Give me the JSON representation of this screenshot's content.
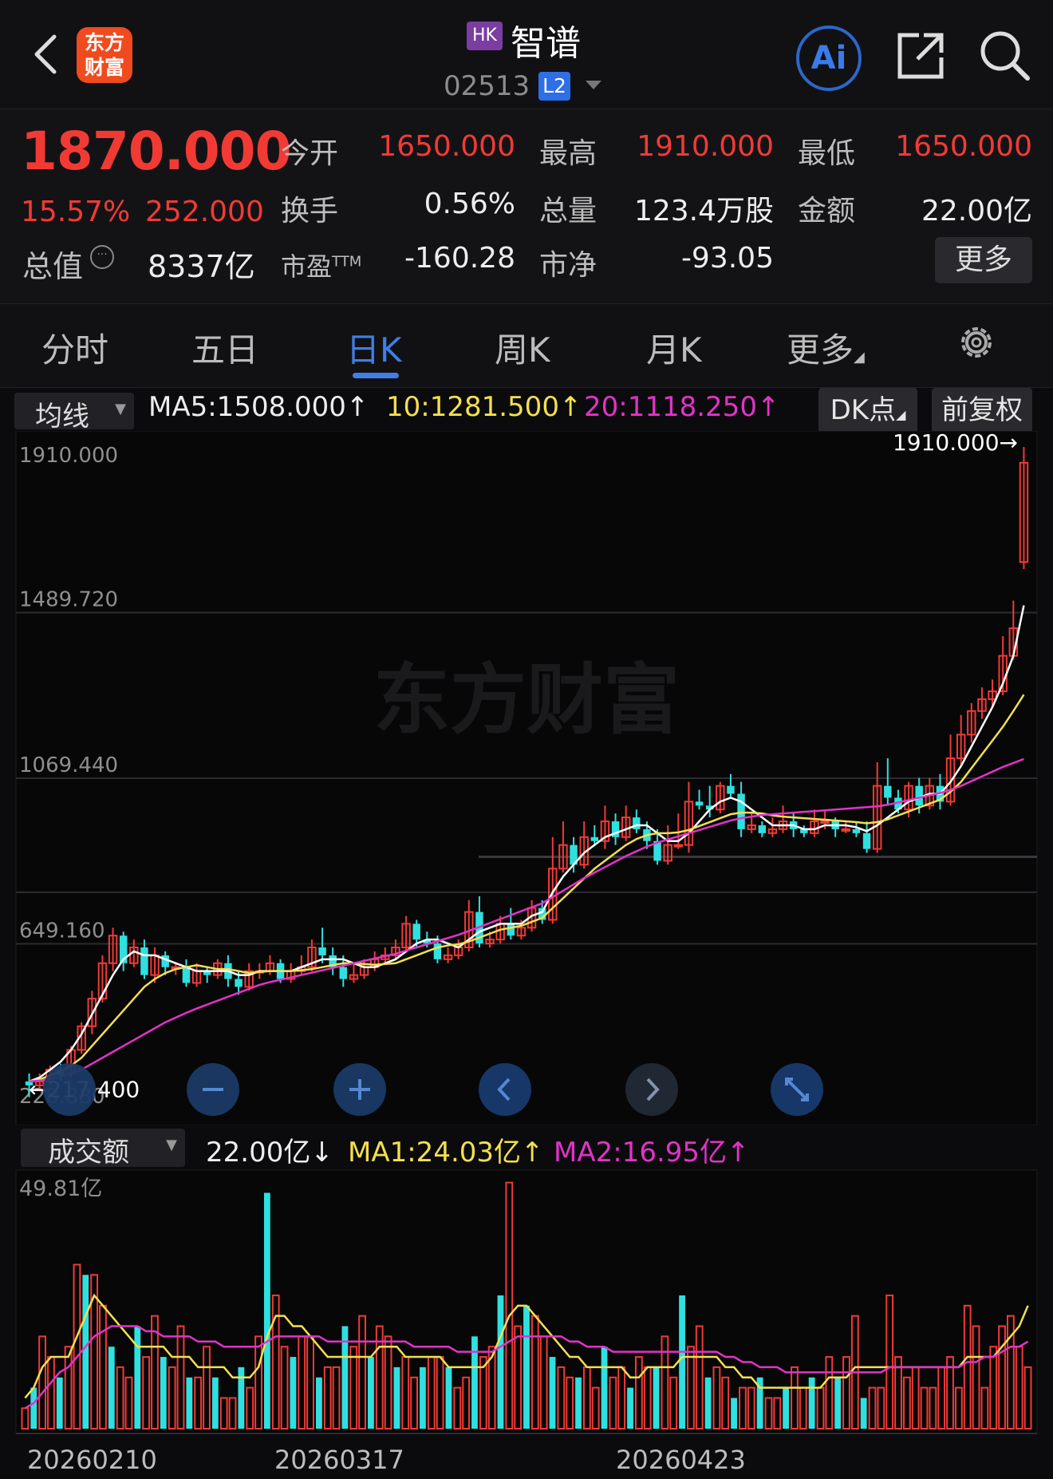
{
  "header": {
    "logo_text_1": "东方",
    "logo_text_2": "财富",
    "market_badge": "HK",
    "stock_name": "智谱",
    "stock_code": "02513",
    "level_badge": "L2",
    "ai_label": "Ai"
  },
  "quote": {
    "price": "1870.000",
    "change_pct": "15.57%",
    "change_amt": "252.000",
    "market_cap_label": "总值",
    "market_cap_value": "8337亿",
    "fields": [
      {
        "label": "今开",
        "value": "1650.000",
        "color": "red"
      },
      {
        "label": "最高",
        "value": "1910.000",
        "color": "red"
      },
      {
        "label": "最低",
        "value": "1650.000",
        "color": "red"
      },
      {
        "label": "换手",
        "value": "0.56%",
        "color": "white"
      },
      {
        "label": "总量",
        "value": "123.4万股",
        "color": "white"
      },
      {
        "label": "金额",
        "value": "22.00亿",
        "color": "white"
      },
      {
        "label": "市盈",
        "label_sup": "TTM",
        "value": "-160.28",
        "color": "white"
      },
      {
        "label": "市净",
        "value": "-93.05",
        "color": "white"
      }
    ],
    "more_label": "更多"
  },
  "tabs": [
    "分时",
    "五日",
    "日K",
    "周K",
    "月K",
    "更多"
  ],
  "active_tab": "日K",
  "ma_row": {
    "selector": "均线",
    "ma5": "MA5:1508.000↑",
    "ma10": "10:1281.500↑",
    "ma20": "20:1118.250↑",
    "dk_label": "DK点",
    "adjust_label": "前复权"
  },
  "volume_row": {
    "selector": "成交额",
    "current": "22.00亿↓",
    "ma1": "MA1:24.03亿↑",
    "ma2": "MA2:16.95亿↑"
  },
  "colors": {
    "up": "#f23a35",
    "down": "#2fe0e0",
    "ma5": "#ffffff",
    "ma10": "#f3e04f",
    "ma20": "#e233c8",
    "accent": "#3f7ee8"
  },
  "chart_data": [
    {
      "type": "candlestick",
      "title": "",
      "y_ticks": [
        "1910.000",
        "1489.720",
        "1069.440",
        "649.160",
        "228.880"
      ],
      "ylim": [
        228.88,
        1910.0
      ],
      "high_annotation": "1910.000→",
      "low_annotation": "←217.400",
      "watermark": "东方财富",
      "reference_line": 870,
      "candles": [
        [
          300,
          290,
          320,
          260
        ],
        [
          290,
          300,
          320,
          280
        ],
        [
          300,
          330,
          340,
          295
        ],
        [
          330,
          315,
          345,
          300
        ],
        [
          320,
          380,
          390,
          310
        ],
        [
          380,
          440,
          450,
          370
        ],
        [
          440,
          510,
          530,
          420
        ],
        [
          510,
          600,
          620,
          500
        ],
        [
          600,
          670,
          690,
          580
        ],
        [
          670,
          600,
          680,
          580
        ],
        [
          600,
          640,
          660,
          590
        ],
        [
          640,
          570,
          660,
          560
        ],
        [
          570,
          620,
          640,
          550
        ],
        [
          620,
          590,
          630,
          570
        ],
        [
          590,
          590,
          600,
          570
        ],
        [
          590,
          550,
          610,
          540
        ],
        [
          550,
          580,
          600,
          540
        ],
        [
          580,
          570,
          590,
          550
        ],
        [
          570,
          600,
          610,
          560
        ],
        [
          600,
          560,
          620,
          540
        ],
        [
          560,
          540,
          580,
          520
        ],
        [
          540,
          580,
          600,
          530
        ],
        [
          580,
          580,
          600,
          560
        ],
        [
          580,
          600,
          620,
          570
        ],
        [
          600,
          560,
          610,
          550
        ],
        [
          560,
          580,
          600,
          550
        ],
        [
          580,
          590,
          620,
          570
        ],
        [
          590,
          640,
          660,
          580
        ],
        [
          640,
          620,
          690,
          600
        ],
        [
          620,
          590,
          640,
          570
        ],
        [
          590,
          560,
          620,
          540
        ],
        [
          560,
          570,
          600,
          550
        ],
        [
          570,
          590,
          610,
          560
        ],
        [
          590,
          610,
          630,
          580
        ],
        [
          610,
          620,
          640,
          600
        ],
        [
          620,
          640,
          660,
          610
        ],
        [
          640,
          700,
          720,
          630
        ],
        [
          700,
          660,
          710,
          640
        ],
        [
          660,
          650,
          680,
          640
        ],
        [
          650,
          610,
          670,
          600
        ],
        [
          610,
          620,
          640,
          600
        ],
        [
          620,
          640,
          660,
          610
        ],
        [
          640,
          730,
          760,
          630
        ],
        [
          730,
          650,
          770,
          640
        ],
        [
          650,
          660,
          680,
          640
        ],
        [
          660,
          700,
          720,
          650
        ],
        [
          700,
          670,
          740,
          660
        ],
        [
          670,
          690,
          710,
          660
        ],
        [
          690,
          740,
          760,
          680
        ],
        [
          740,
          710,
          760,
          700
        ],
        [
          710,
          840,
          920,
          700
        ],
        [
          840,
          900,
          960,
          830
        ],
        [
          900,
          850,
          920,
          830
        ],
        [
          850,
          920,
          960,
          840
        ],
        [
          920,
          910,
          950,
          900
        ],
        [
          910,
          960,
          1000,
          890
        ],
        [
          960,
          920,
          980,
          900
        ],
        [
          920,
          970,
          1000,
          910
        ],
        [
          970,
          940,
          990,
          930
        ],
        [
          940,
          910,
          960,
          890
        ],
        [
          910,
          860,
          940,
          850
        ],
        [
          860,
          900,
          950,
          850
        ],
        [
          900,
          900,
          980,
          890
        ],
        [
          900,
          1010,
          1060,
          880
        ],
        [
          1010,
          1000,
          1040,
          990
        ],
        [
          1000,
          990,
          1050,
          970
        ],
        [
          990,
          1050,
          1060,
          980
        ],
        [
          1050,
          1030,
          1080,
          1020
        ],
        [
          1030,
          940,
          1060,
          920
        ],
        [
          940,
          950,
          980,
          930
        ],
        [
          950,
          930,
          960,
          920
        ],
        [
          930,
          940,
          970,
          920
        ],
        [
          940,
          960,
          1000,
          930
        ],
        [
          960,
          940,
          980,
          920
        ],
        [
          940,
          930,
          950,
          920
        ],
        [
          930,
          960,
          990,
          920
        ],
        [
          960,
          960,
          990,
          940
        ],
        [
          960,
          940,
          970,
          920
        ],
        [
          940,
          940,
          960,
          930
        ],
        [
          940,
          930,
          960,
          920
        ],
        [
          930,
          890,
          960,
          880
        ],
        [
          890,
          1050,
          1110,
          880
        ],
        [
          1050,
          1020,
          1120,
          1000
        ],
        [
          1020,
          990,
          1040,
          980
        ],
        [
          990,
          1050,
          1060,
          970
        ],
        [
          1050,
          1000,
          1070,
          980
        ],
        [
          1000,
          1050,
          1070,
          990
        ],
        [
          1050,
          1010,
          1080,
          990
        ],
        [
          1010,
          1120,
          1180,
          1000
        ],
        [
          1120,
          1180,
          1230,
          1100
        ],
        [
          1180,
          1240,
          1260,
          1160
        ],
        [
          1240,
          1270,
          1300,
          1220
        ],
        [
          1270,
          1290,
          1320,
          1250
        ],
        [
          1290,
          1380,
          1430,
          1280
        ],
        [
          1380,
          1450,
          1520,
          1370
        ],
        [
          1618,
          1870,
          1910,
          1600
        ]
      ],
      "ma5": [
        300,
        310,
        330,
        350,
        380,
        420,
        470,
        520,
        570,
        610,
        630,
        620,
        620,
        610,
        600,
        590,
        580,
        580,
        580,
        580,
        570,
        570,
        580,
        580,
        580,
        580,
        590,
        600,
        610,
        610,
        610,
        600,
        590,
        590,
        600,
        610,
        630,
        650,
        660,
        660,
        650,
        640,
        660,
        680,
        690,
        700,
        700,
        700,
        720,
        730,
        780,
        820,
        850,
        880,
        900,
        920,
        930,
        940,
        950,
        950,
        930,
        910,
        910,
        930,
        960,
        990,
        1010,
        1020,
        1010,
        990,
        970,
        950,
        950,
        950,
        940,
        940,
        950,
        950,
        950,
        945,
        935,
        950,
        970,
        990,
        1010,
        1020,
        1030,
        1030,
        1060,
        1100,
        1150,
        1200,
        1250,
        1310,
        1380,
        1508
      ],
      "ma10": [
        300,
        305,
        315,
        325,
        340,
        360,
        390,
        420,
        450,
        480,
        510,
        540,
        560,
        575,
        585,
        590,
        595,
        590,
        585,
        585,
        580,
        575,
        578,
        580,
        580,
        580,
        582,
        585,
        590,
        595,
        600,
        600,
        598,
        596,
        598,
        600,
        610,
        620,
        630,
        640,
        645,
        648,
        655,
        665,
        675,
        685,
        690,
        695,
        705,
        715,
        740,
        765,
        790,
        815,
        840,
        860,
        880,
        900,
        915,
        925,
        930,
        930,
        932,
        938,
        948,
        958,
        968,
        978,
        982,
        982,
        980,
        975,
        972,
        970,
        968,
        966,
        964,
        962,
        960,
        958,
        955,
        958,
        965,
        975,
        985,
        995,
        1005,
        1015,
        1035,
        1060,
        1095,
        1130,
        1165,
        1200,
        1240,
        1281.5
      ],
      "ma20": [
        300,
        302,
        306,
        312,
        320,
        330,
        345,
        360,
        375,
        390,
        405,
        420,
        435,
        450,
        462,
        474,
        485,
        495,
        505,
        515,
        525,
        535,
        545,
        552,
        558,
        564,
        570,
        576,
        582,
        588,
        594,
        600,
        606,
        612,
        618,
        624,
        632,
        640,
        648,
        656,
        664,
        672,
        682,
        692,
        702,
        712,
        722,
        732,
        742,
        752,
        768,
        784,
        800,
        816,
        830,
        844,
        858,
        872,
        884,
        896,
        906,
        914,
        922,
        930,
        938,
        946,
        954,
        962,
        968,
        972,
        976,
        978,
        980,
        982,
        984,
        986,
        988,
        990,
        992,
        994,
        996,
        998,
        1002,
        1008,
        1014,
        1020,
        1026,
        1032,
        1040,
        1050,
        1062,
        1074,
        1086,
        1098,
        1108,
        1118.25
      ]
    },
    {
      "type": "bar",
      "title": "",
      "y_ticks": [
        "49.81亿"
      ],
      "ylim": [
        0,
        49.81
      ],
      "x_ticks": [
        "20260210",
        "20260317",
        "20260423"
      ],
      "values": [
        4,
        8,
        18,
        14,
        10,
        16,
        32,
        30,
        30,
        24,
        16,
        12,
        10,
        20,
        14,
        22,
        14,
        12,
        20,
        10,
        10,
        16,
        10,
        6,
        6,
        12,
        8,
        18,
        46,
        26,
        16,
        14,
        18,
        18,
        10,
        12,
        12,
        20,
        16,
        22,
        14,
        20,
        18,
        12,
        14,
        10,
        12,
        14,
        14,
        12,
        8,
        10,
        18,
        14,
        16,
        26,
        48,
        20,
        24,
        22,
        18,
        14,
        12,
        10,
        10,
        12,
        8,
        16,
        10,
        12,
        8,
        14,
        12,
        12,
        18,
        10,
        26,
        16,
        20,
        10,
        12,
        10,
        6,
        8,
        8,
        10,
        6,
        6,
        8,
        12,
        8,
        10,
        8,
        14,
        10,
        14,
        22,
        6,
        8,
        8,
        26,
        14,
        10,
        12,
        8,
        8,
        12,
        14,
        8,
        24,
        20,
        8,
        16,
        20,
        22,
        16,
        12
      ],
      "ma1": [
        6,
        8,
        12,
        14,
        14,
        14,
        18,
        22,
        26,
        24,
        22,
        20,
        18,
        16,
        16,
        16,
        16,
        14,
        14,
        14,
        12,
        12,
        12,
        12,
        10,
        10,
        10,
        12,
        18,
        22,
        22,
        20,
        20,
        18,
        16,
        14,
        14,
        14,
        14,
        14,
        14,
        16,
        16,
        16,
        14,
        14,
        14,
        14,
        14,
        12,
        12,
        12,
        12,
        12,
        14,
        18,
        22,
        24,
        24,
        22,
        20,
        18,
        16,
        14,
        14,
        12,
        12,
        12,
        12,
        12,
        10,
        10,
        12,
        12,
        12,
        12,
        14,
        14,
        14,
        14,
        14,
        12,
        12,
        10,
        10,
        8,
        8,
        8,
        8,
        8,
        8,
        8,
        8,
        10,
        10,
        10,
        12,
        12,
        12,
        12,
        12,
        12,
        12,
        12,
        12,
        12,
        12,
        12,
        12,
        14,
        14,
        14,
        14,
        16,
        18,
        20,
        24
      ],
      "ma2": [
        4,
        5,
        7,
        9,
        11,
        12,
        14,
        16,
        18,
        19,
        20,
        20,
        20,
        20,
        19,
        19,
        18,
        18,
        18,
        18,
        17,
        17,
        17,
        16,
        16,
        16,
        16,
        16,
        17,
        18,
        18,
        18,
        18,
        18,
        18,
        17,
        17,
        17,
        17,
        17,
        17,
        17,
        17,
        17,
        17,
        16,
        16,
        16,
        16,
        16,
        15,
        15,
        15,
        15,
        15,
        16,
        17,
        18,
        18,
        18,
        18,
        18,
        18,
        17,
        17,
        16,
        16,
        16,
        15,
        15,
        15,
        15,
        15,
        15,
        15,
        15,
        15,
        15,
        15,
        15,
        15,
        14,
        14,
        13,
        13,
        12,
        12,
        12,
        11,
        11,
        11,
        11,
        11,
        11,
        11,
        11,
        11,
        11,
        11,
        11,
        12,
        12,
        12,
        12,
        12,
        12,
        12,
        12,
        12,
        13,
        13,
        14,
        14,
        15,
        16,
        16,
        17
      ]
    }
  ]
}
